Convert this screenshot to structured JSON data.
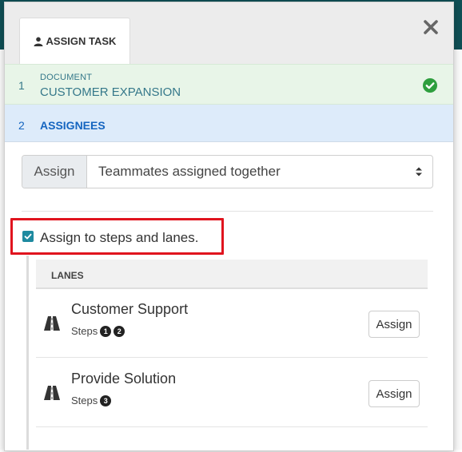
{
  "tab": {
    "label": "ASSIGN TASK",
    "icon": "user-icon"
  },
  "close": {
    "icon": "close-icon"
  },
  "steps": [
    {
      "number": "1",
      "label": "DOCUMENT",
      "title": "CUSTOMER EXPANSION",
      "status_icon": "check-circle-icon",
      "color": "#2e9e3e"
    },
    {
      "number": "2",
      "title": "ASSIGNEES"
    }
  ],
  "assign": {
    "addon_label": "Assign",
    "selected": "Teammates assigned together"
  },
  "option": {
    "label": "Assign to steps and lanes.",
    "checked": true
  },
  "lanes": {
    "header": "LANES",
    "items": [
      {
        "name": "Customer Support",
        "steps_label": "Steps",
        "steps": [
          "1",
          "2"
        ],
        "button": "Assign",
        "icon": "road-icon"
      },
      {
        "name": "Provide Solution",
        "steps_label": "Steps",
        "steps": [
          "3"
        ],
        "button": "Assign",
        "icon": "road-icon"
      }
    ]
  },
  "colors": {
    "accent": "#1e8aa0",
    "highlight": "#e0141e",
    "header_bar": "#0f4f55"
  }
}
